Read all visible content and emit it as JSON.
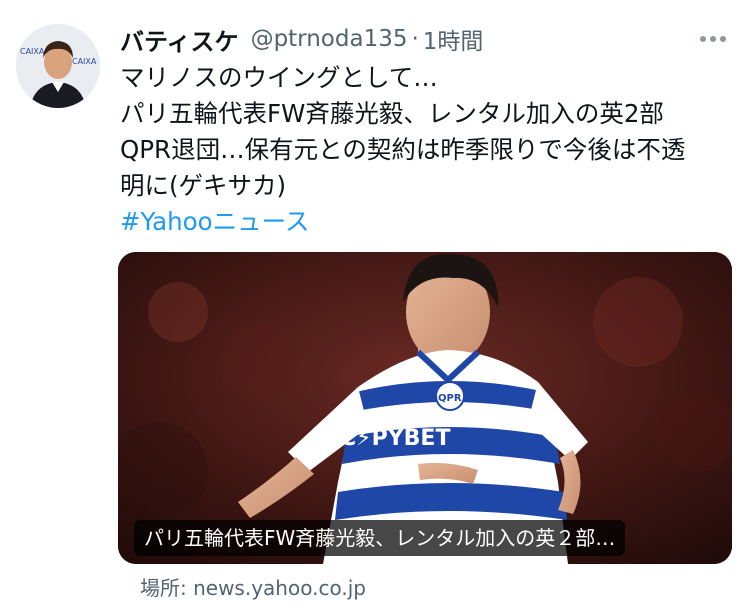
{
  "tweet": {
    "display_name": "バティスケ",
    "handle": "@ptrnoda135",
    "separator": "·",
    "time": "1時間",
    "lines": [
      "マリノスのウイングとして…",
      "パリ五輪代表FW斉藤光毅、レンタル加入の英2部",
      "QPR退団…保有元との契約は昨季限りで今後は不透",
      "明に(ゲキサカ)"
    ],
    "hashtag": "#Yahooニュース"
  },
  "card": {
    "caption": "パリ五輪代表FW斉藤光毅、レンタル加入の英２部…",
    "source": "場所: news.yahoo.co.jp",
    "jersey_text": "C⚡PYBET",
    "crest_text": "QPR"
  },
  "icons": {
    "more": "more-horizontal-icon"
  },
  "colors": {
    "link": "#1d9bf0",
    "secondary_text": "#536471",
    "jersey_blue": "#1f47a8"
  }
}
